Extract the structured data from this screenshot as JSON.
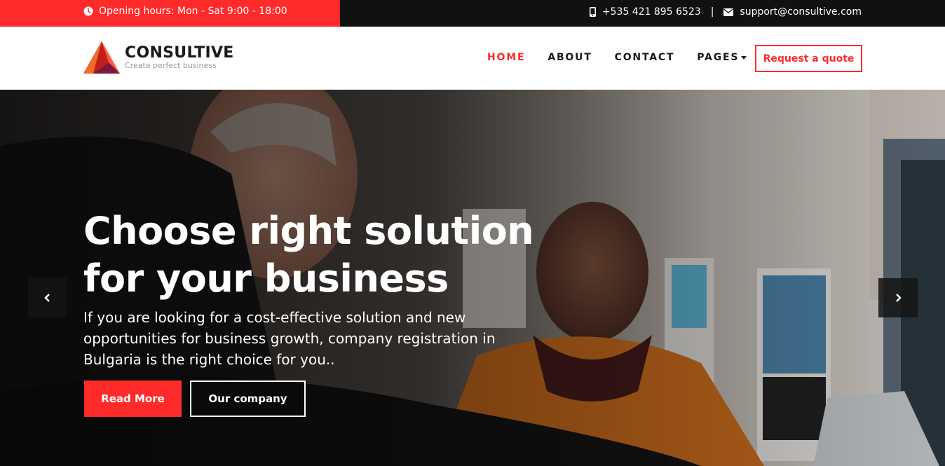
{
  "topbar": {
    "hours": "Opening hours: Mon - Sat 9:00 - 18:00",
    "phone": "+535 421 895 6523",
    "separator": "|",
    "email": "support@consultive.com"
  },
  "header": {
    "brand": "CONSULTIVE",
    "tagline": "Create perfect business",
    "nav": [
      {
        "label": "HOME",
        "active": true
      },
      {
        "label": "ABOUT",
        "active": false
      },
      {
        "label": "CONTACT",
        "active": false
      },
      {
        "label": "PAGES",
        "active": false
      }
    ],
    "quote_button": "Request a quote"
  },
  "hero": {
    "title": "Choose right solution for your business",
    "text": "If you are looking for a cost-effective solution and new opportunities for business growth, company registration in Bulgaria is the right choice for you..",
    "primary_button": "Read More",
    "secondary_button": "Our company"
  },
  "colors": {
    "accent": "#ff2a2a",
    "topbar": "#111111"
  },
  "icons": {
    "hours": "clock-icon",
    "phone": "phone-icon",
    "email": "envelope-icon",
    "prev": "chevron-left-icon",
    "next": "chevron-right-icon"
  }
}
